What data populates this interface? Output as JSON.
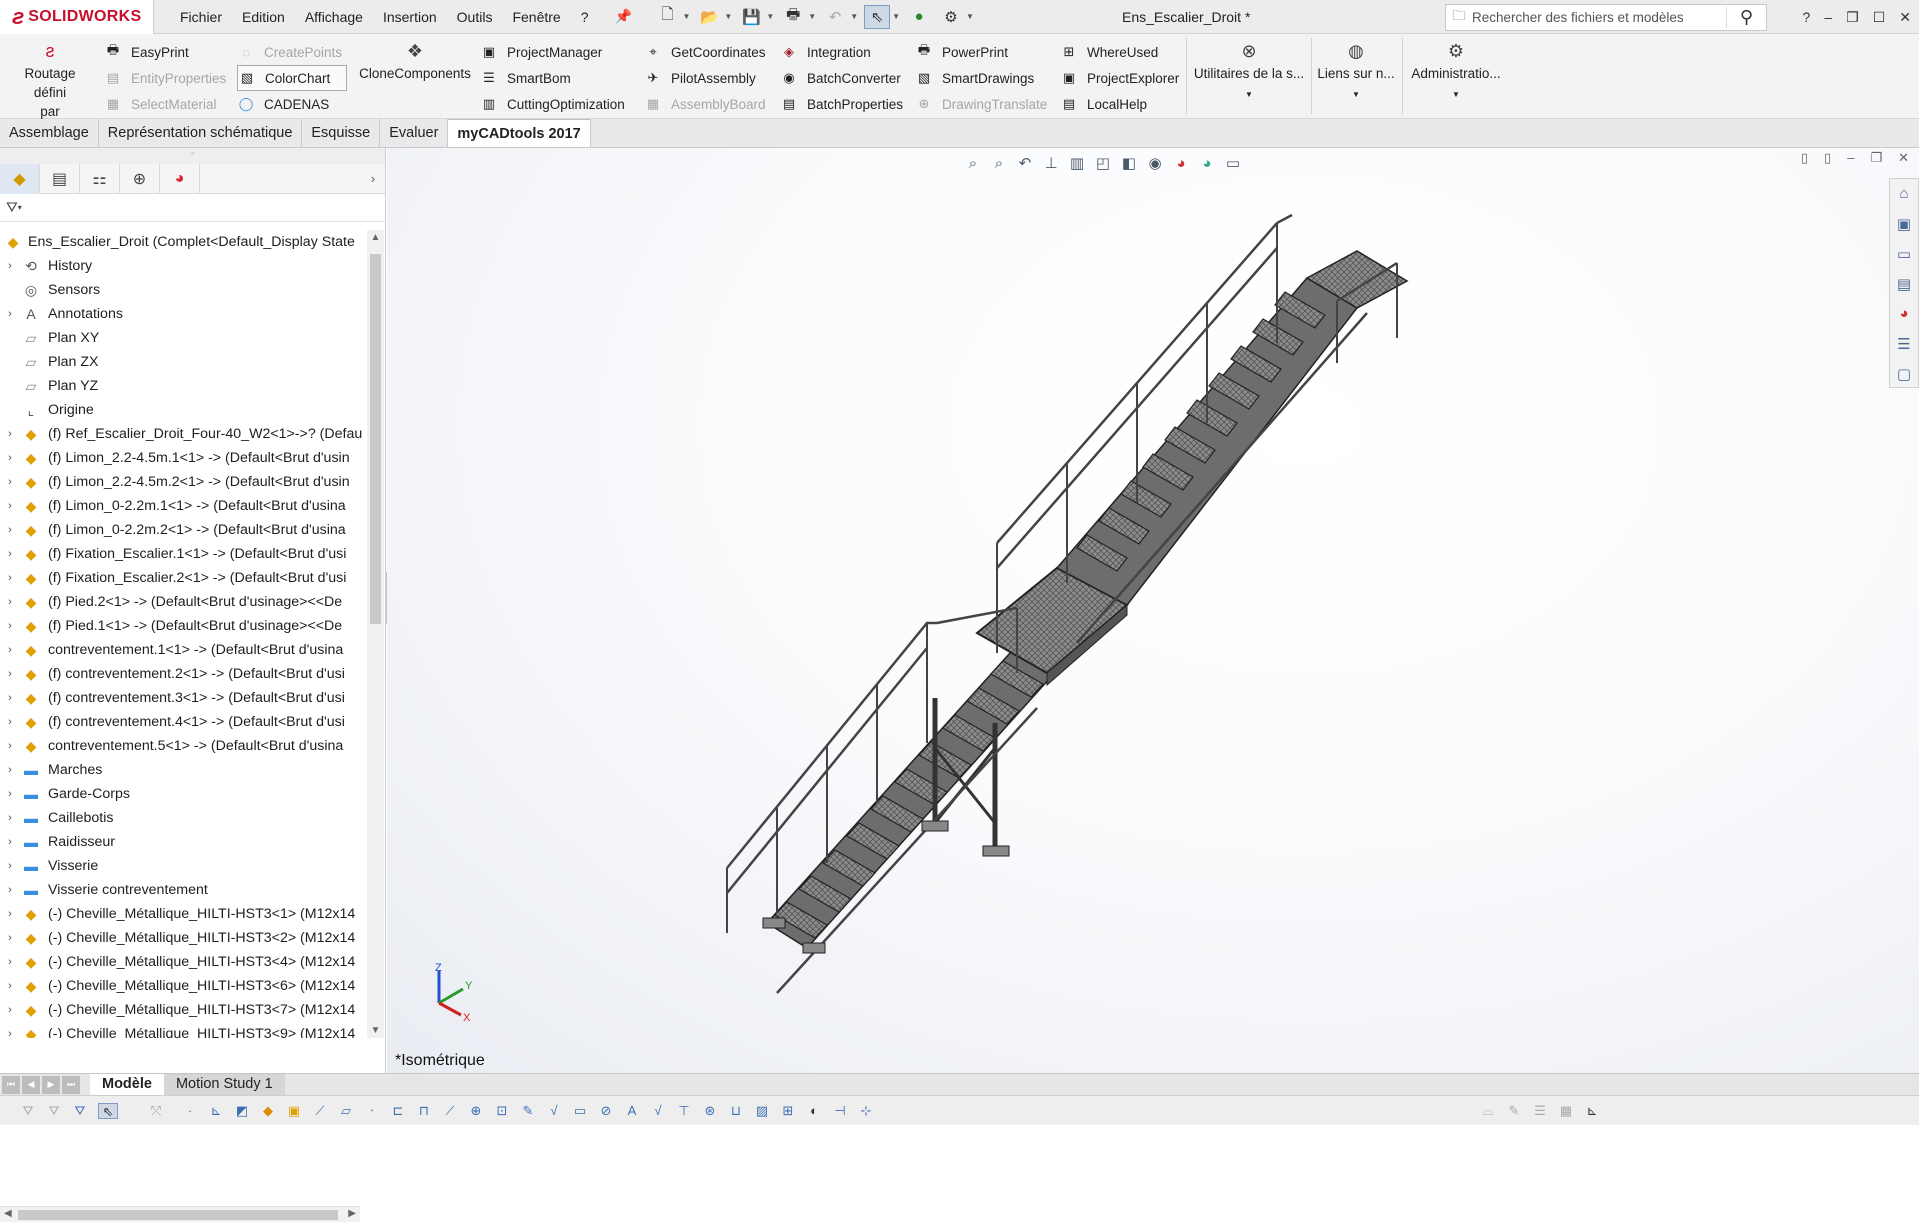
{
  "app": {
    "name": "SOLIDWORKS",
    "logo_text": "SOLIDWORKS"
  },
  "menu": [
    "Fichier",
    "Edition",
    "Affichage",
    "Insertion",
    "Outils",
    "Fenêtre",
    "?"
  ],
  "document_title": "Ens_Escalier_Droit *",
  "search": {
    "placeholder": "Rechercher des fichiers et modèles"
  },
  "help_label": "?",
  "ribbon": {
    "routing": {
      "line1": "Routage défini",
      "line2": "par l'utilisateur"
    },
    "col1": [
      "EasyPrint",
      "EntityProperties",
      "SelectMaterial"
    ],
    "col2": [
      "CreatePoints",
      "ColorChart",
      "CADENAS"
    ],
    "clone": "CloneComponents",
    "col3": [
      "ProjectManager",
      "SmartBom",
      "CuttingOptimization"
    ],
    "col4": [
      "GetCoordinates",
      "PilotAssembly",
      "AssemblyBoard"
    ],
    "col5": [
      "Integration",
      "BatchConverter",
      "BatchProperties"
    ],
    "col6": [
      "PowerPrint",
      "SmartDrawings",
      "DrawingTranslate"
    ],
    "col7": [
      "WhereUsed",
      "ProjectExplorer",
      "LocalHelp"
    ],
    "utilities": "Utilitaires de la s...",
    "links": "Liens sur n...",
    "admin": "Administratio..."
  },
  "tabs": [
    "Assemblage",
    "Représentation schématique",
    "Esquisse",
    "Evaluer",
    "myCADtools 2017"
  ],
  "active_tab": "myCADtools 2017",
  "tree": {
    "root": "Ens_Escalier_Droit  (Complet<Default_Display State",
    "items": [
      {
        "label": "History",
        "icon": "history-icon",
        "expand": true
      },
      {
        "label": "Sensors",
        "icon": "sensors-icon",
        "expand": false
      },
      {
        "label": "Annotations",
        "icon": "annotations-icon",
        "expand": true
      },
      {
        "label": "Plan XY",
        "icon": "plane-icon",
        "expand": false
      },
      {
        "label": "Plan ZX",
        "icon": "plane-icon",
        "expand": false
      },
      {
        "label": "Plan YZ",
        "icon": "plane-icon",
        "expand": false
      },
      {
        "label": "Origine",
        "icon": "origin-icon",
        "expand": false
      },
      {
        "label": "(f) Ref_Escalier_Droit_Four-40_W2<1>->? (Defau",
        "icon": "part-icon",
        "expand": true
      },
      {
        "label": "(f) Limon_2.2-4.5m.1<1> -> (Default<Brut d'usin",
        "icon": "part-icon",
        "expand": true
      },
      {
        "label": "(f) Limon_2.2-4.5m.2<1> -> (Default<Brut d'usin",
        "icon": "part-icon",
        "expand": true
      },
      {
        "label": "(f) Limon_0-2.2m.1<1> -> (Default<Brut d'usina",
        "icon": "part-icon",
        "expand": true
      },
      {
        "label": "(f) Limon_0-2.2m.2<1> -> (Default<Brut d'usina",
        "icon": "part-icon",
        "expand": true
      },
      {
        "label": "(f) Fixation_Escalier.1<1> -> (Default<Brut d'usi",
        "icon": "part-icon",
        "expand": true
      },
      {
        "label": "(f) Fixation_Escalier.2<1> -> (Default<Brut d'usi",
        "icon": "part-icon",
        "expand": true
      },
      {
        "label": "(f) Pied.2<1> -> (Default<Brut d'usinage><<De",
        "icon": "part-icon",
        "expand": true
      },
      {
        "label": "(f) Pied.1<1> -> (Default<Brut d'usinage><<De",
        "icon": "part-icon",
        "expand": true
      },
      {
        "label": "contreventement.1<1> -> (Default<Brut d'usina",
        "icon": "part-icon",
        "expand": true
      },
      {
        "label": "(f) contreventement.2<1> -> (Default<Brut d'usi",
        "icon": "part-icon",
        "expand": true
      },
      {
        "label": "(f) contreventement.3<1> -> (Default<Brut d'usi",
        "icon": "part-icon",
        "expand": true
      },
      {
        "label": "(f) contreventement.4<1> -> (Default<Brut d'usi",
        "icon": "part-icon",
        "expand": true
      },
      {
        "label": "contreventement.5<1> -> (Default<Brut d'usina",
        "icon": "part-icon",
        "expand": true
      },
      {
        "label": "Marches",
        "icon": "folder-icon",
        "expand": true
      },
      {
        "label": "Garde-Corps",
        "icon": "folder-icon",
        "expand": true
      },
      {
        "label": "Caillebotis",
        "icon": "folder-icon",
        "expand": true
      },
      {
        "label": "Raidisseur",
        "icon": "folder-icon",
        "expand": true
      },
      {
        "label": "Visserie",
        "icon": "folder-icon",
        "expand": true
      },
      {
        "label": "Visserie contreventement",
        "icon": "folder-icon",
        "expand": true
      },
      {
        "label": "(-) Cheville_Métallique_HILTI-HST3<1> (M12x14",
        "icon": "part-icon",
        "expand": true
      },
      {
        "label": "(-) Cheville_Métallique_HILTI-HST3<2> (M12x14",
        "icon": "part-icon",
        "expand": true
      },
      {
        "label": "(-) Cheville_Métallique_HILTI-HST3<4> (M12x14",
        "icon": "part-icon",
        "expand": true
      },
      {
        "label": "(-) Cheville_Métallique_HILTI-HST3<6> (M12x14",
        "icon": "part-icon",
        "expand": true
      },
      {
        "label": "(-) Cheville_Métallique_HILTI-HST3<7> (M12x14",
        "icon": "part-icon",
        "expand": true
      },
      {
        "label": "(-) Cheville_Métallique_HILTI-HST3<9> (M12x14",
        "icon": "part-icon",
        "expand": true
      }
    ]
  },
  "viewport": {
    "view_label": "*Isométrique",
    "triad": {
      "x": "X",
      "y": "Y",
      "z": "Z"
    }
  },
  "bottom_tabs": [
    "Modèle",
    "Motion Study 1"
  ],
  "active_bottom_tab": "Modèle",
  "colors": {
    "brand_red": "#c8102e",
    "part_yellow": "#e0a000",
    "folder_blue": "#3a8ee0"
  }
}
